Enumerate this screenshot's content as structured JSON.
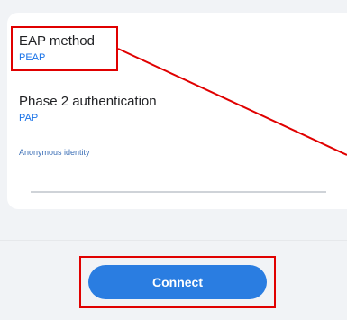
{
  "eap_method": {
    "title": "EAP method",
    "value": "PEAP"
  },
  "phase2": {
    "title": "Phase 2 authentication",
    "value": "PAP"
  },
  "anonymous_identity": {
    "label": "Anonymous identity"
  },
  "connect": {
    "label": "Connect"
  },
  "colors": {
    "accent": "#2a7de1",
    "value_text": "#1a73e8",
    "highlight": "#e00000"
  }
}
